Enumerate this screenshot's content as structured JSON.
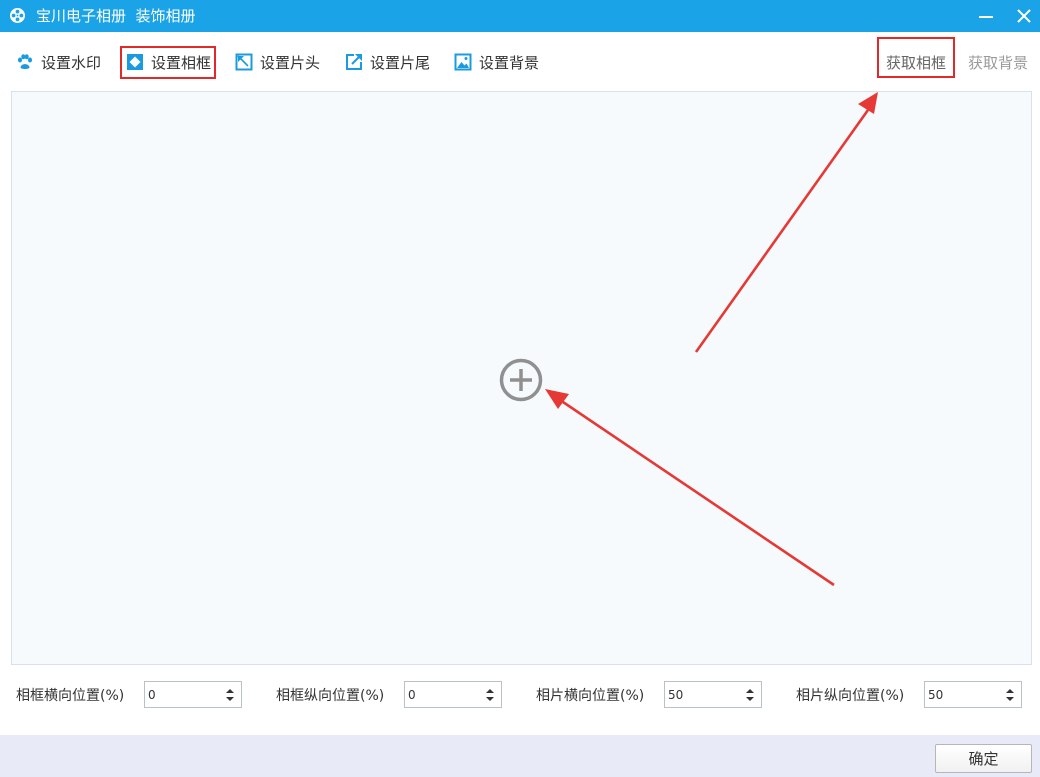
{
  "window": {
    "title": "宝川电子相册  装饰相册",
    "app_icon": "film-reel-icon",
    "minimize_icon": "minimize-icon",
    "close_icon": "close-icon",
    "titlebar_color": "#1aa3e6"
  },
  "toolbar": {
    "tabs": [
      {
        "label": "设置水印",
        "icon": "paw-icon"
      },
      {
        "label": "设置相框",
        "icon": "frame-icon",
        "highlighted": true
      },
      {
        "label": "设置片头",
        "icon": "opening-icon"
      },
      {
        "label": "设置片尾",
        "icon": "ending-icon"
      },
      {
        "label": "设置背景",
        "icon": "background-image-icon"
      }
    ],
    "get_frame_label": "获取相框",
    "get_background_label": "获取背景"
  },
  "canvas": {
    "add_icon": "plus-circle-icon"
  },
  "positions": [
    {
      "label": "相框横向位置(%)",
      "value": "0"
    },
    {
      "label": "相框纵向位置(%)",
      "value": "0"
    },
    {
      "label": "相片横向位置(%)",
      "value": "50"
    },
    {
      "label": "相片纵向位置(%)",
      "value": "50"
    }
  ],
  "footer": {
    "ok_label": "确定"
  },
  "colors": {
    "accent": "#1aa3e6",
    "highlight": "#e02a2a",
    "annotation_arrow": "#e53935"
  }
}
